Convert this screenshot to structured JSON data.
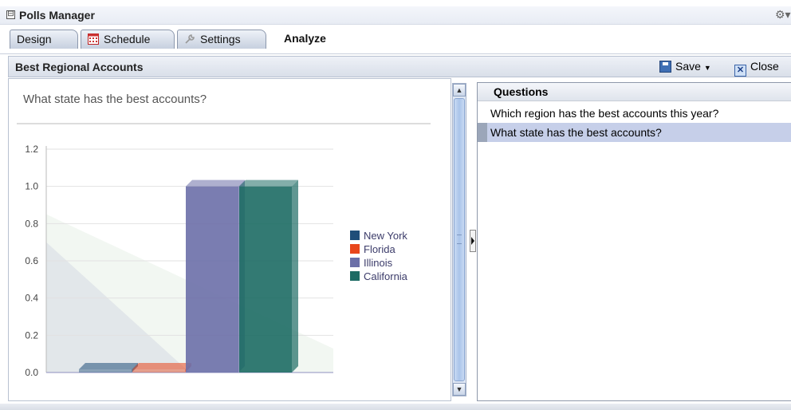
{
  "app": {
    "title": "Polls Manager",
    "collapse_glyph": "⊟",
    "settings_icon": "gear-icon",
    "settings_glyph": "⚙▾"
  },
  "tabs": [
    {
      "label": "Design",
      "icon": null,
      "active": false
    },
    {
      "label": "Schedule",
      "icon": "calendar-icon",
      "active": false
    },
    {
      "label": "Settings",
      "icon": "wrench-icon",
      "active": false
    },
    {
      "label": "Analyze",
      "icon": null,
      "active": true
    }
  ],
  "panel": {
    "title": "Best Regional Accounts",
    "save_label": "Save",
    "close_label": "Close"
  },
  "chart_heading": "What state has the best accounts?",
  "chart_data": {
    "type": "bar",
    "title": "",
    "categories": [
      "New York",
      "Florida",
      "Illinois",
      "California"
    ],
    "values": [
      0,
      0,
      1,
      1
    ],
    "series": [
      {
        "name": "New York",
        "values": [
          0
        ],
        "color": "#1f4e79"
      },
      {
        "name": "Florida",
        "values": [
          0
        ],
        "color": "#e8461c"
      },
      {
        "name": "Illinois",
        "values": [
          1
        ],
        "color": "#6b6fa8"
      },
      {
        "name": "California",
        "values": [
          1
        ],
        "color": "#1d6b64"
      }
    ],
    "yticks": [
      "0.0",
      "0.2",
      "0.4",
      "0.6",
      "0.8",
      "1.0",
      "1.2"
    ],
    "ylim": [
      0,
      1.2
    ],
    "xlabel": "",
    "ylabel": "",
    "grid": true,
    "legend_position": "right"
  },
  "questions": {
    "header": "Questions",
    "items": [
      {
        "text": "Which region has the best accounts this year?",
        "selected": false
      },
      {
        "text": "What state has the best accounts?",
        "selected": true
      }
    ]
  }
}
